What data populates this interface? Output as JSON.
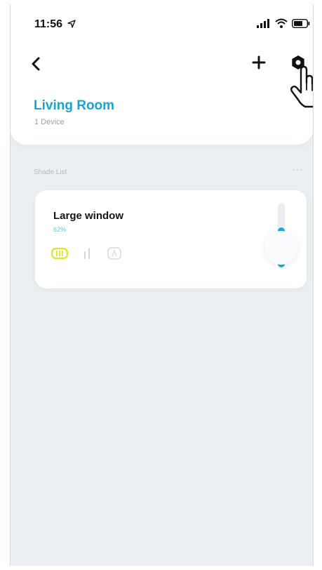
{
  "status_bar": {
    "time": "11:56",
    "icons": [
      "location-arrow-icon",
      "signal-icon",
      "wifi-icon",
      "battery-icon"
    ]
  },
  "nav": {
    "back_icon": "chevron-left-icon",
    "add_icon": "plus-icon",
    "settings_icon": "gear-icon"
  },
  "room": {
    "title": "Living Room",
    "subtitle": "1 Device"
  },
  "section": {
    "label": "Shade List",
    "more": "···"
  },
  "shades": [
    {
      "name": "Large window",
      "position_text": "62%",
      "position_percent": 62,
      "controls": [
        "open-icon",
        "stop-icon",
        "close-icon"
      ]
    }
  ],
  "colors": {
    "accent": "#1aa3cf",
    "slider_fill": "#27a7dd",
    "open_control": "#d7e83a",
    "background": "#eceff1"
  }
}
